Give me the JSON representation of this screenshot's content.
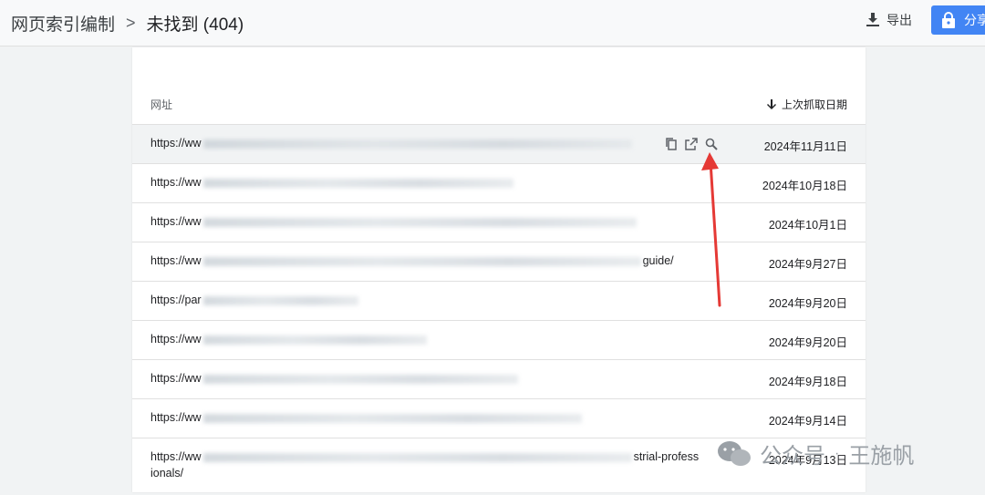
{
  "header": {
    "breadcrumb_parent": "网页索引编制",
    "breadcrumb_separator": ">",
    "breadcrumb_current": "未找到 (404)",
    "export_label": "导出",
    "share_label": "分享"
  },
  "table": {
    "col_url": "网址",
    "col_date": "上次抓取日期",
    "rows": [
      {
        "url_prefix": "https://ww",
        "url_tail": "",
        "date": "2024年11月11日"
      },
      {
        "url_prefix": "https://ww",
        "url_tail": "",
        "date": "2024年10月18日"
      },
      {
        "url_prefix": "https://ww",
        "url_tail": "",
        "date": "2024年10月1日"
      },
      {
        "url_prefix": "https://ww",
        "url_tail": "guide/",
        "date": "2024年9月27日"
      },
      {
        "url_prefix": "https://par",
        "url_tail": "",
        "date": "2024年9月20日"
      },
      {
        "url_prefix": "https://ww",
        "url_tail": "",
        "date": "2024年9月20日"
      },
      {
        "url_prefix": "https://ww",
        "url_tail": "",
        "date": "2024年9月18日"
      },
      {
        "url_prefix": "https://ww",
        "url_tail": "",
        "date": "2024年9月14日"
      },
      {
        "url_prefix": "https://ww",
        "url_tail": "strial-profess",
        "url_line2": "ionals/",
        "date": "2024年9月13日"
      }
    ]
  },
  "watermark": {
    "text1": "公众号",
    "dot": "·",
    "text2": "王施帆"
  },
  "colors": {
    "accent": "#4285f4",
    "annotation": "#e53935"
  }
}
